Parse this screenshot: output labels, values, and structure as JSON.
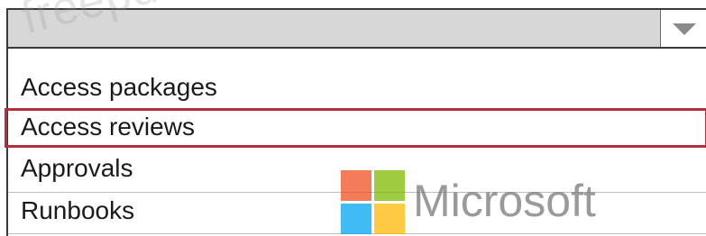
{
  "dropdown": {
    "selected_value": "",
    "options": [
      {
        "label": "Access packages"
      },
      {
        "label": "Access reviews"
      },
      {
        "label": "Approvals"
      },
      {
        "label": "Runbooks"
      }
    ],
    "highlighted_index": 1,
    "highlight_color": "#b0313d",
    "box_background": "#d7d7d7"
  },
  "watermarks": {
    "site": "freepdf",
    "brand": "Microsoft",
    "brand_colors": [
      "#f25022",
      "#7fba00",
      "#00a4ef",
      "#ffb900"
    ]
  }
}
